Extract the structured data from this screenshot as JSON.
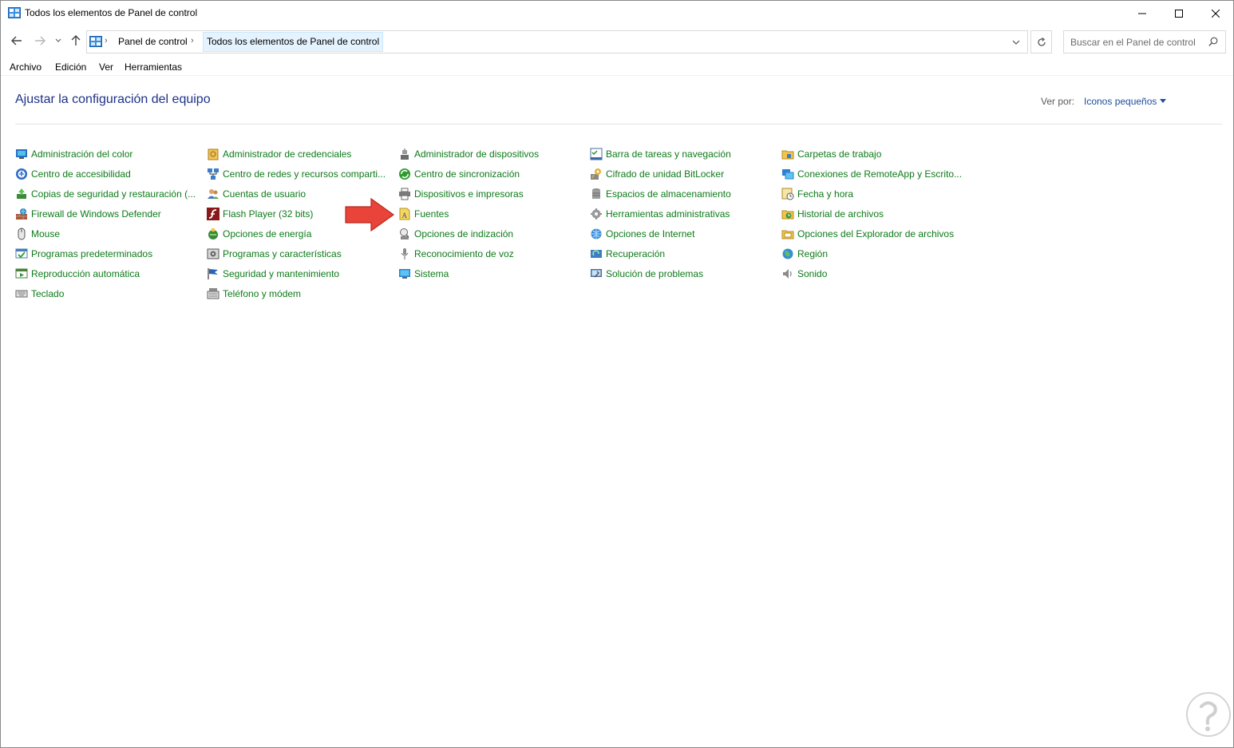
{
  "window": {
    "title": "Todos los elementos de Panel de control"
  },
  "navigation": {
    "back_icon": "back-arrow-icon",
    "forward_icon": "forward-arrow-icon",
    "recent_icon": "chevron-down-icon",
    "up_icon": "up-arrow-icon",
    "breadcrumbs": [
      "Panel de control",
      "Todos los elementos de Panel de control"
    ],
    "search_placeholder": "Buscar en el Panel de control"
  },
  "menu": [
    "Archivo",
    "Edición",
    "Ver",
    "Herramientas"
  ],
  "content": {
    "title": "Ajustar la configuración del equipo",
    "view_by_label": "Ver por:",
    "view_by_value": "Iconos pequeños",
    "link_color": "#0e7a19",
    "title_color": "#1e3287"
  },
  "columns": [
    [
      {
        "label": "Administración del color",
        "icon": "color-management-icon"
      },
      {
        "label": "Centro de accesibilidad",
        "icon": "accessibility-icon"
      },
      {
        "label": "Copias de seguridad y restauración (...",
        "icon": "backup-icon"
      },
      {
        "label": "Firewall de Windows Defender",
        "icon": "firewall-icon"
      },
      {
        "label": "Mouse",
        "icon": "mouse-icon"
      },
      {
        "label": "Programas predeterminados",
        "icon": "default-programs-icon"
      },
      {
        "label": "Reproducción automática",
        "icon": "autoplay-icon"
      },
      {
        "label": "Teclado",
        "icon": "keyboard-icon"
      }
    ],
    [
      {
        "label": "Administrador de credenciales",
        "icon": "credential-manager-icon"
      },
      {
        "label": "Centro de redes y recursos comparti...",
        "icon": "network-icon"
      },
      {
        "label": "Cuentas de usuario",
        "icon": "user-accounts-icon"
      },
      {
        "label": "Flash Player (32 bits)",
        "icon": "flash-icon"
      },
      {
        "label": "Opciones de energía",
        "icon": "power-icon"
      },
      {
        "label": "Programas y características",
        "icon": "programs-icon"
      },
      {
        "label": "Seguridad y mantenimiento",
        "icon": "flag-icon"
      },
      {
        "label": "Teléfono y módem",
        "icon": "phone-modem-icon"
      }
    ],
    [
      {
        "label": "Administrador de dispositivos",
        "icon": "device-manager-icon"
      },
      {
        "label": "Centro de sincronización",
        "icon": "sync-icon"
      },
      {
        "label": "Dispositivos e impresoras",
        "icon": "printer-icon"
      },
      {
        "label": "Fuentes",
        "icon": "fonts-icon"
      },
      {
        "label": "Opciones de indización",
        "icon": "indexing-icon"
      },
      {
        "label": "Reconocimiento de voz",
        "icon": "microphone-icon"
      },
      {
        "label": "Sistema",
        "icon": "system-icon"
      }
    ],
    [
      {
        "label": "Barra de tareas y navegación",
        "icon": "taskbar-icon"
      },
      {
        "label": "Cifrado de unidad BitLocker",
        "icon": "bitlocker-icon"
      },
      {
        "label": "Espacios de almacenamiento",
        "icon": "storage-icon"
      },
      {
        "label": "Herramientas administrativas",
        "icon": "admin-tools-icon"
      },
      {
        "label": "Opciones de Internet",
        "icon": "internet-options-icon"
      },
      {
        "label": "Recuperación",
        "icon": "recovery-icon"
      },
      {
        "label": "Solución de problemas",
        "icon": "troubleshooting-icon"
      }
    ],
    [
      {
        "label": "Carpetas de trabajo",
        "icon": "work-folders-icon"
      },
      {
        "label": "Conexiones de RemoteApp y Escrito...",
        "icon": "remoteapp-icon"
      },
      {
        "label": "Fecha y hora",
        "icon": "date-time-icon"
      },
      {
        "label": "Historial de archivos",
        "icon": "file-history-icon"
      },
      {
        "label": "Opciones del Explorador de archivos",
        "icon": "folder-options-icon"
      },
      {
        "label": "Región",
        "icon": "region-icon"
      },
      {
        "label": "Sonido",
        "icon": "speaker-icon"
      }
    ]
  ],
  "annotation": {
    "arrow_color": "#e8443a",
    "arrow_icon": "red-arrow-icon",
    "watermark_icon": "watermark-logo-icon"
  }
}
